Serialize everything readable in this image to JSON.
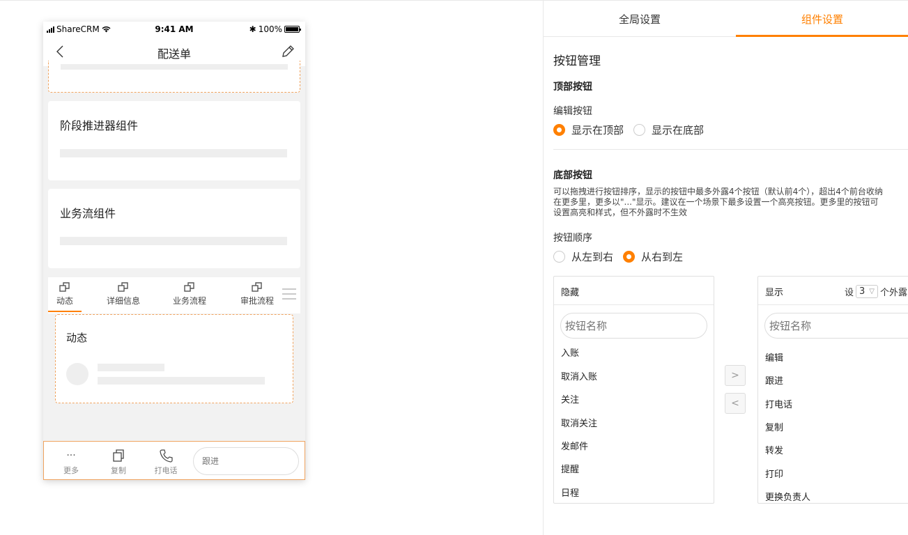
{
  "phone": {
    "status": {
      "carrier": "ShareCRM",
      "time": "9:41 AM",
      "battery": "100%"
    },
    "nav": {
      "title": "配送单",
      "back_icon": "chevron-left-icon",
      "edit_icon": "pencil-icon"
    },
    "cards": [
      {
        "title": "阶段推进器组件"
      },
      {
        "title": "业务流组件"
      }
    ],
    "tabs": [
      {
        "label": "动态",
        "active": true
      },
      {
        "label": "详细信息",
        "active": false
      },
      {
        "label": "业务流程",
        "active": false
      },
      {
        "label": "审批流程",
        "active": false
      }
    ],
    "activity_section": {
      "title": "动态"
    },
    "bottom_bar": {
      "more_glyph": "···",
      "more_label": "更多",
      "copy_label": "复制",
      "call_label": "打电话",
      "follow_placeholder": "跟进"
    }
  },
  "settings": {
    "tabs": [
      {
        "label": "全局设置",
        "active": false
      },
      {
        "label": "组件设置",
        "active": true
      }
    ],
    "accent_color": "#ff8000",
    "section_title": "按钮管理",
    "top_buttons": {
      "heading": "顶部按钮",
      "edit_label": "编辑按钮",
      "options": [
        {
          "label": "显示在顶部",
          "selected": true
        },
        {
          "label": "显示在底部",
          "selected": false
        }
      ]
    },
    "bottom_buttons": {
      "heading": "底部按钮",
      "description_lines": [
        "可以拖拽进行按钮排序，显示的按钮中最多外露4个按钮（默认前4个），超出4个前台收纳",
        "在更多里，更多以\"...\"显示。建议在一个场景下最多设置一个高亮按钮。更多里的按钮可",
        "设置高亮和样式，但不外露时不生效"
      ],
      "order_label": "按钮顺序",
      "order_options": [
        {
          "label": "从左到右",
          "selected": false
        },
        {
          "label": "从右到左",
          "selected": true
        }
      ]
    },
    "hidden_list": {
      "title": "隐藏",
      "search_placeholder": "按钮名称",
      "items": [
        "入账",
        "取消入账",
        "关注",
        "取消关注",
        "发邮件",
        "提醒",
        "日程"
      ]
    },
    "shown_list": {
      "title": "显示",
      "config_prefix": "设",
      "config_value": "3",
      "config_suffix": "个外露",
      "search_placeholder": "按钮名称",
      "items": [
        "编辑",
        "跟进",
        "打电话",
        "复制",
        "转发",
        "打印",
        "更换负责人"
      ]
    },
    "move_right_glyph": ">",
    "move_left_glyph": "<"
  }
}
